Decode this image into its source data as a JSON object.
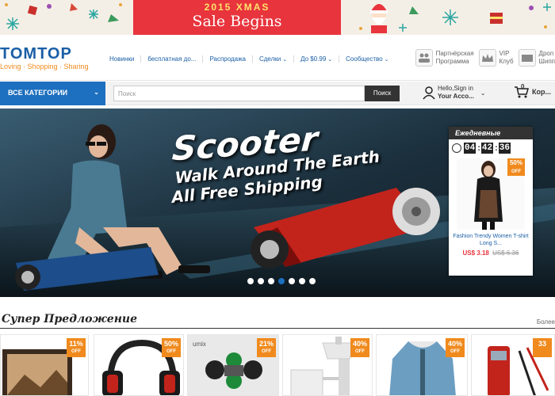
{
  "promo": {
    "year": "2015",
    "xmas": "XMAS",
    "sale": "Sale Begins"
  },
  "header": {
    "logo_name": "TOMTOP",
    "logo_tagline": "Loving · Shopping · Sharing",
    "nav": [
      {
        "label": "Новинки",
        "has_dropdown": false
      },
      {
        "label": "бесплатная до...",
        "has_dropdown": false
      },
      {
        "label": "Распродажа",
        "has_dropdown": false
      },
      {
        "label": "Сделки",
        "has_dropdown": true
      },
      {
        "label": "До $0.99",
        "has_dropdown": true
      },
      {
        "label": "Сообщество",
        "has_dropdown": true
      }
    ],
    "links": [
      {
        "line1": "Партнёрская",
        "line2": "Программа",
        "icon": "affiliate-icon"
      },
      {
        "line1": "VIP",
        "line2": "Клуб",
        "icon": "crown-icon"
      },
      {
        "line1": "Дроп",
        "line2": "Шипп",
        "icon": "dropship-icon"
      }
    ]
  },
  "search": {
    "categories_label": "ВСЕ КАТЕГОРИИ",
    "placeholder": "Поиск",
    "button_label": "Поиск",
    "account_line1": "Hello,Sign in",
    "account_line2": "Your Acco...",
    "cart_count": "0",
    "cart_label": "Кор..."
  },
  "hero": {
    "title": "Scooter",
    "line2": "Walk Around The Earth",
    "line3": "All Free Shipping",
    "slides": 7,
    "active_slide": 4
  },
  "deal": {
    "header": "Ежедневные",
    "timer": [
      "04",
      "42",
      "36"
    ],
    "discount": "50%",
    "discount_label": "OFF",
    "product": "Fashion Trendy Women T-shirt Long S...",
    "price_now": "US$ 3.18",
    "price_old": "US$ 6.36"
  },
  "super": {
    "title": "Супер Предложение",
    "more": "Более"
  },
  "products": [
    {
      "discount": "11%",
      "off": "OFF"
    },
    {
      "discount": "50%",
      "off": "OFF"
    },
    {
      "discount": "21%",
      "off": "OFF"
    },
    {
      "discount": "40%",
      "off": "OFF"
    },
    {
      "discount": "40%",
      "off": "OFF"
    },
    {
      "discount": "33",
      "off": ""
    }
  ],
  "colors": {
    "brand_blue": "#1d6fbf",
    "accent_orange": "#f08a1d",
    "promo_red": "#e8343d"
  }
}
